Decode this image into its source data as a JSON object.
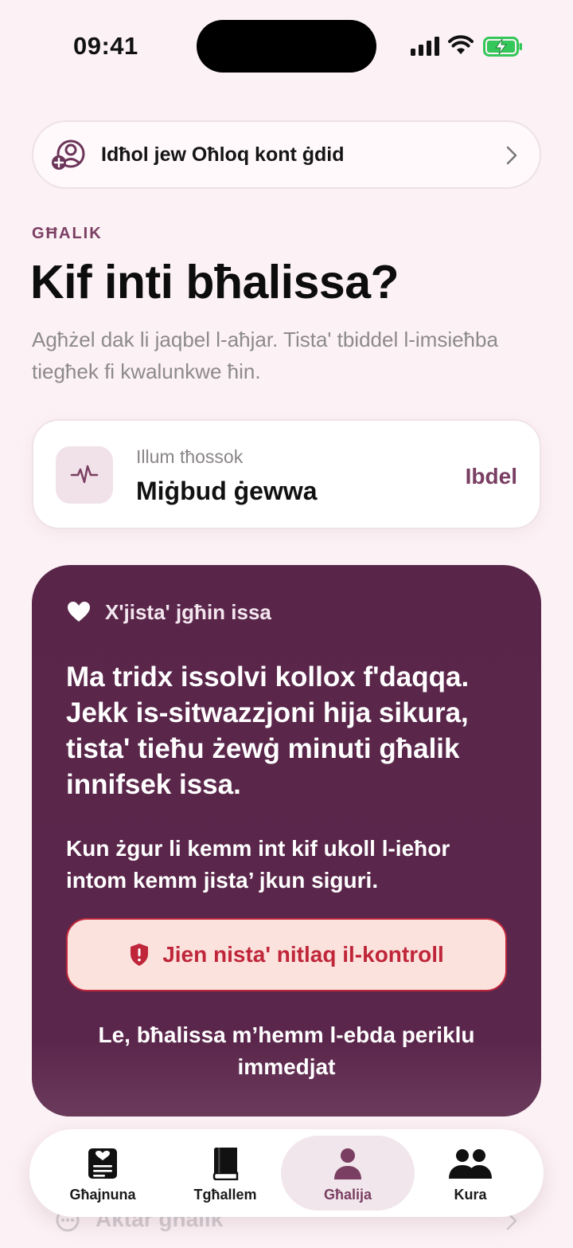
{
  "status_bar": {
    "time": "09:41"
  },
  "account": {
    "label": "Idħol jew Oħloq kont ġdid"
  },
  "header": {
    "eyebrow": "GĦALIK",
    "title": "Kif inti bħalissa?",
    "subtitle": "Agħżel dak li jaqbel l-aħjar. Tista' tbiddel l-imsieħba tiegħek fi kwalunkwe ħin."
  },
  "feeling": {
    "caption": "Illum tħossok",
    "value": "Miġbud ġewwa",
    "change_label": "Ibdel"
  },
  "pause_card": {
    "header": "X'jista' jgħin issa",
    "main_text": "Ma tridx issolvi kollox f'daqqa. Jekk is-sitwazzjoni hija sikura, tista' tieħu żewġ minuti għalik innifsek issa.",
    "secondary_text": "Kun żgur li kemm int kif ukoll l-ieħor intom kemm jista’ jkun siguri.",
    "button_label": "Jien nista' nitlaq il-kontroll",
    "link_text": "Le, bħalissa m’hemm l-ebda periklu immedjat"
  },
  "faded_row": {
    "label": "Aktar għalik"
  },
  "tabs": [
    {
      "label": "Għajnuna",
      "icon": "help-card-icon"
    },
    {
      "label": "Tgħallem",
      "icon": "book-icon"
    },
    {
      "label": "Għalija",
      "icon": "person-icon",
      "selected": true
    },
    {
      "label": "Kura",
      "icon": "people-icon"
    }
  ],
  "colors": {
    "background": "#fcf1f5",
    "accent": "#7a3e62",
    "card_purple": "#59264a",
    "danger": "#c0263a",
    "danger_bg": "#fbe2dd",
    "battery_green": "#34c759"
  }
}
